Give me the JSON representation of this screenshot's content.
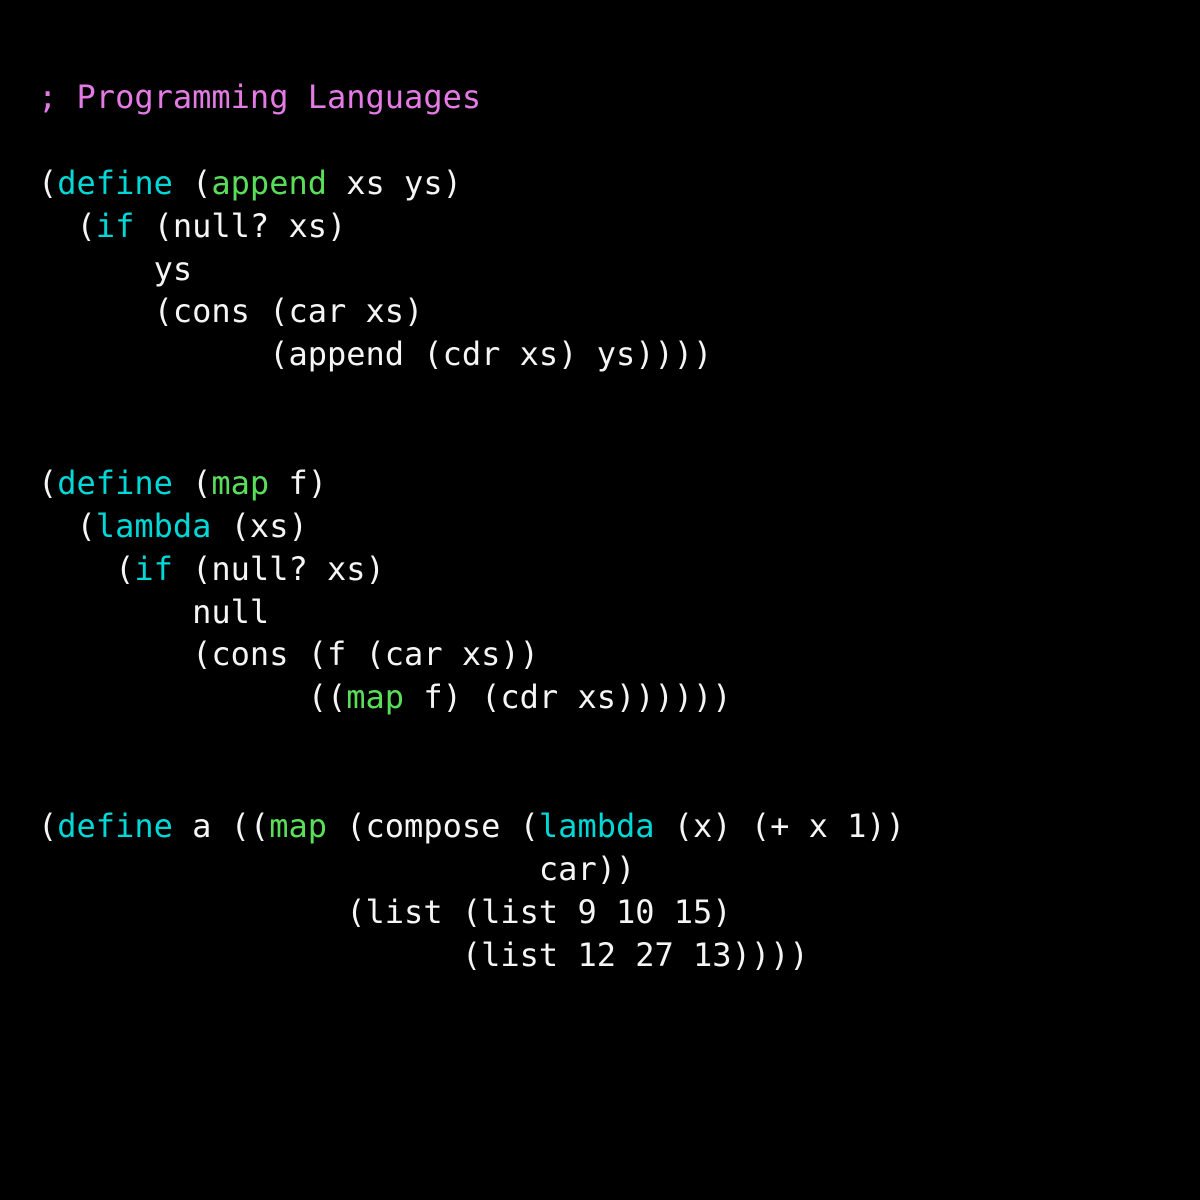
{
  "comment": "; Programming Languages",
  "kw": {
    "define": "define",
    "if": "if",
    "lambda": "lambda"
  },
  "fn": {
    "append": "append",
    "map": "map"
  },
  "id": {
    "xs": "xs",
    "ys": "ys",
    "null_q": "null?",
    "cons": "cons",
    "car": "car",
    "cdr": "cdr",
    "f": "f",
    "null": "null",
    "a": "a",
    "compose": "compose",
    "x": "x",
    "plus": "+",
    "list": "list"
  },
  "num": {
    "n1": "1",
    "n9": "9",
    "n10": "10",
    "n15": "15",
    "n12": "12",
    "n27": "27",
    "n13": "13"
  }
}
